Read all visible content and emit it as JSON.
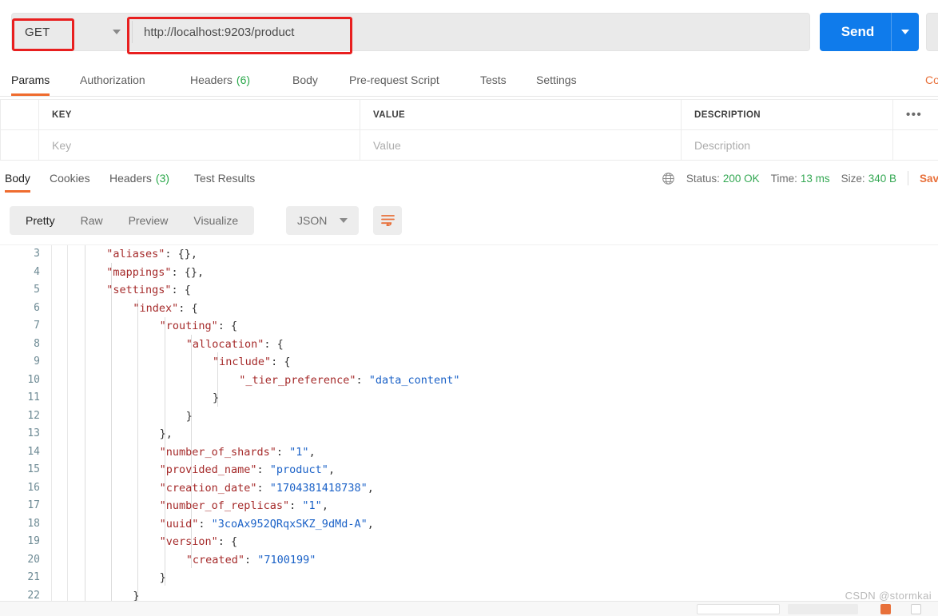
{
  "request": {
    "method": "GET",
    "method_caret": "chevron-down",
    "url": "http://localhost:9203/product",
    "send_label": "Send",
    "tabs": [
      {
        "label": "Params",
        "count": "",
        "active": true
      },
      {
        "label": "Authorization",
        "count": "",
        "active": false
      },
      {
        "label": "Headers",
        "count": "(6)",
        "active": false
      },
      {
        "label": "Body",
        "count": "",
        "active": false
      },
      {
        "label": "Pre-request Script",
        "count": "",
        "active": false
      },
      {
        "label": "Tests",
        "count": "",
        "active": false
      },
      {
        "label": "Settings",
        "count": "",
        "active": false
      }
    ],
    "cookies_link": "Co"
  },
  "params_table": {
    "headers": [
      "",
      "KEY",
      "VALUE",
      "DESCRIPTION",
      "•••"
    ],
    "row": {
      "key_placeholder": "Key",
      "value_placeholder": "Value",
      "description_placeholder": "Description"
    }
  },
  "response": {
    "tabs": [
      {
        "label": "Body",
        "count": "",
        "active": true
      },
      {
        "label": "Cookies",
        "count": "",
        "active": false
      },
      {
        "label": "Headers",
        "count": "(3)",
        "active": false
      },
      {
        "label": "Test Results",
        "count": "",
        "active": false
      }
    ],
    "status_label": "Status:",
    "status_value": "200 OK",
    "time_label": "Time:",
    "time_value": "13 ms",
    "size_label": "Size:",
    "size_value": "340 B",
    "save_response": "Save R",
    "viewer_modes": [
      "Pretty",
      "Raw",
      "Preview",
      "Visualize"
    ],
    "active_mode": "Pretty",
    "format": "JSON",
    "wrap_icon": "wrap-lines-icon"
  },
  "code": {
    "lines": [
      {
        "num": "3",
        "indent": 4,
        "tokens": [
          {
            "t": "\"aliases\"",
            "c": "k"
          },
          {
            "t": ": {},",
            "c": "p"
          }
        ]
      },
      {
        "num": "4",
        "indent": 4,
        "tokens": [
          {
            "t": "\"mappings\"",
            "c": "k"
          },
          {
            "t": ": {},",
            "c": "p"
          }
        ]
      },
      {
        "num": "5",
        "indent": 4,
        "tokens": [
          {
            "t": "\"settings\"",
            "c": "k"
          },
          {
            "t": ": {",
            "c": "p"
          }
        ]
      },
      {
        "num": "6",
        "indent": 8,
        "tokens": [
          {
            "t": "\"index\"",
            "c": "k"
          },
          {
            "t": ": {",
            "c": "p"
          }
        ]
      },
      {
        "num": "7",
        "indent": 12,
        "tokens": [
          {
            "t": "\"routing\"",
            "c": "k"
          },
          {
            "t": ": {",
            "c": "p"
          }
        ]
      },
      {
        "num": "8",
        "indent": 16,
        "tokens": [
          {
            "t": "\"allocation\"",
            "c": "k"
          },
          {
            "t": ": {",
            "c": "p"
          }
        ]
      },
      {
        "num": "9",
        "indent": 20,
        "tokens": [
          {
            "t": "\"include\"",
            "c": "k"
          },
          {
            "t": ": {",
            "c": "p"
          }
        ]
      },
      {
        "num": "10",
        "indent": 24,
        "tokens": [
          {
            "t": "\"_tier_preference\"",
            "c": "k"
          },
          {
            "t": ": ",
            "c": "p"
          },
          {
            "t": "\"data_content\"",
            "c": "s"
          }
        ]
      },
      {
        "num": "11",
        "indent": 20,
        "tokens": [
          {
            "t": "}",
            "c": "p"
          }
        ]
      },
      {
        "num": "12",
        "indent": 16,
        "tokens": [
          {
            "t": "}",
            "c": "p"
          }
        ]
      },
      {
        "num": "13",
        "indent": 12,
        "tokens": [
          {
            "t": "},",
            "c": "p"
          }
        ]
      },
      {
        "num": "14",
        "indent": 12,
        "tokens": [
          {
            "t": "\"number_of_shards\"",
            "c": "k"
          },
          {
            "t": ": ",
            "c": "p"
          },
          {
            "t": "\"1\"",
            "c": "s"
          },
          {
            "t": ",",
            "c": "p"
          }
        ]
      },
      {
        "num": "15",
        "indent": 12,
        "tokens": [
          {
            "t": "\"provided_name\"",
            "c": "k"
          },
          {
            "t": ": ",
            "c": "p"
          },
          {
            "t": "\"product\"",
            "c": "s"
          },
          {
            "t": ",",
            "c": "p"
          }
        ]
      },
      {
        "num": "16",
        "indent": 12,
        "tokens": [
          {
            "t": "\"creation_date\"",
            "c": "k"
          },
          {
            "t": ": ",
            "c": "p"
          },
          {
            "t": "\"1704381418738\"",
            "c": "s"
          },
          {
            "t": ",",
            "c": "p"
          }
        ]
      },
      {
        "num": "17",
        "indent": 12,
        "tokens": [
          {
            "t": "\"number_of_replicas\"",
            "c": "k"
          },
          {
            "t": ": ",
            "c": "p"
          },
          {
            "t": "\"1\"",
            "c": "s"
          },
          {
            "t": ",",
            "c": "p"
          }
        ]
      },
      {
        "num": "18",
        "indent": 12,
        "tokens": [
          {
            "t": "\"uuid\"",
            "c": "k"
          },
          {
            "t": ": ",
            "c": "p"
          },
          {
            "t": "\"3coAx952QRqxSKZ_9dMd-A\"",
            "c": "s"
          },
          {
            "t": ",",
            "c": "p"
          }
        ]
      },
      {
        "num": "19",
        "indent": 12,
        "tokens": [
          {
            "t": "\"version\"",
            "c": "k"
          },
          {
            "t": ": {",
            "c": "p"
          }
        ]
      },
      {
        "num": "20",
        "indent": 16,
        "tokens": [
          {
            "t": "\"created\"",
            "c": "k"
          },
          {
            "t": ": ",
            "c": "p"
          },
          {
            "t": "\"7100199\"",
            "c": "s"
          }
        ]
      },
      {
        "num": "21",
        "indent": 12,
        "tokens": [
          {
            "t": "}",
            "c": "p"
          }
        ]
      },
      {
        "num": "22",
        "indent": 8,
        "tokens": [
          {
            "t": "}",
            "c": "p"
          }
        ]
      }
    ]
  },
  "watermark": "CSDN @stormkai",
  "colors": {
    "accent_orange": "#ef6c2f",
    "send_blue": "#0f7beb",
    "status_green": "#34a853",
    "annotation_red": "#e81f1f",
    "json_key": "#a52a2a",
    "json_string": "#1a61c7"
  }
}
